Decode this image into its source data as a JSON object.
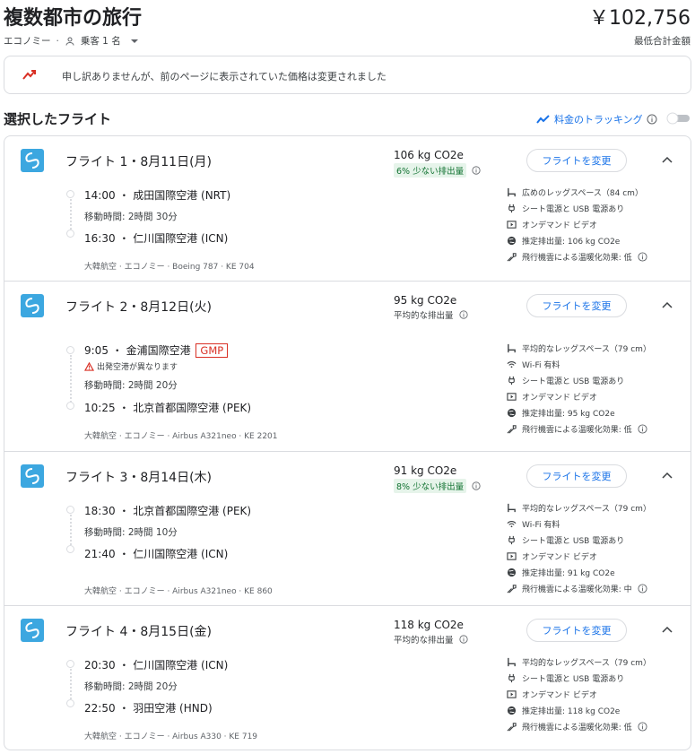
{
  "header": {
    "title": "複数都市の旅行",
    "price": "￥102,756",
    "cabin": "エコノミー",
    "passengers": "乗客 1 名",
    "price_note": "最低合計金額"
  },
  "notice": {
    "message": "申し訳ありませんが、前のページに表示されていた価格は変更されました"
  },
  "selected": {
    "title": "選択したフライト",
    "tracking_label": "料金のトラッキング"
  },
  "flights": [
    {
      "name": "フライト 1・8月11日(月)",
      "emission": "106 kg CO2e",
      "emission_note": "6% 少ない排出量",
      "emission_highlight": true,
      "change_label": "フライトを変更",
      "dep": "14:00 ・ 成田国際空港 (NRT)",
      "duration": "移動時間: 2時間 30分",
      "arr": "16:30 ・ 仁川国際空港 (ICN)",
      "airline": "大韓航空 · エコノミー · Boeing 787 · KE 704",
      "amenities": [
        "広めのレッグスペース（84 cm）",
        "シート電源と USB 電源あり",
        "オンデマンド ビデオ",
        "推定排出量: 106 kg CO2e",
        "飛行機雲による温暖化効果: 低"
      ]
    },
    {
      "name": "フライト 2・8月12日(火)",
      "emission": "95 kg CO2e",
      "emission_note": "平均的な排出量",
      "emission_highlight": false,
      "change_label": "フライトを変更",
      "dep": "9:05 ・ 金浦国際空港",
      "dep_badge": "GMP",
      "warning": "出発空港が異なります",
      "duration": "移動時間: 2時間 20分",
      "arr": "10:25 ・ 北京首都国際空港 (PEK)",
      "airline": "大韓航空 · エコノミー · Airbus A321neo · KE 2201",
      "amenities": [
        "平均的なレッグスペース（79 cm）",
        "Wi-Fi 有料",
        "シート電源と USB 電源あり",
        "オンデマンド ビデオ",
        "推定排出量: 95 kg CO2e",
        "飛行機雲による温暖化効果: 低"
      ]
    },
    {
      "name": "フライト 3・8月14日(木)",
      "emission": "91 kg CO2e",
      "emission_note": "8% 少ない排出量",
      "emission_highlight": true,
      "change_label": "フライトを変更",
      "dep": "18:30 ・ 北京首都国際空港 (PEK)",
      "duration": "移動時間: 2時間 10分",
      "arr": "21:40 ・ 仁川国際空港 (ICN)",
      "airline": "大韓航空 · エコノミー · Airbus A321neo · KE 860",
      "amenities": [
        "平均的なレッグスペース（79 cm）",
        "Wi-Fi 有料",
        "シート電源と USB 電源あり",
        "オンデマンド ビデオ",
        "推定排出量: 91 kg CO2e",
        "飛行機雲による温暖化効果: 中"
      ]
    },
    {
      "name": "フライト 4・8月15日(金)",
      "emission": "118 kg CO2e",
      "emission_note": "平均的な排出量",
      "emission_highlight": false,
      "change_label": "フライトを変更",
      "dep": "20:30 ・ 仁川国際空港 (ICN)",
      "duration": "移動時間: 2時間 20分",
      "arr": "22:50 ・ 羽田空港 (HND)",
      "airline": "大韓航空 · エコノミー · Airbus A330 · KE 719",
      "amenities": [
        "平均的なレッグスペース（79 cm）",
        "シート電源と USB 電源あり",
        "オンデマンド ビデオ",
        "推定排出量: 118 kg CO2e",
        "飛行機雲による温暖化効果: 低"
      ]
    }
  ],
  "colors": {
    "accent": "#1a73e8",
    "green": "#137333",
    "red": "#d93025",
    "logo": "#3ca7e0"
  }
}
